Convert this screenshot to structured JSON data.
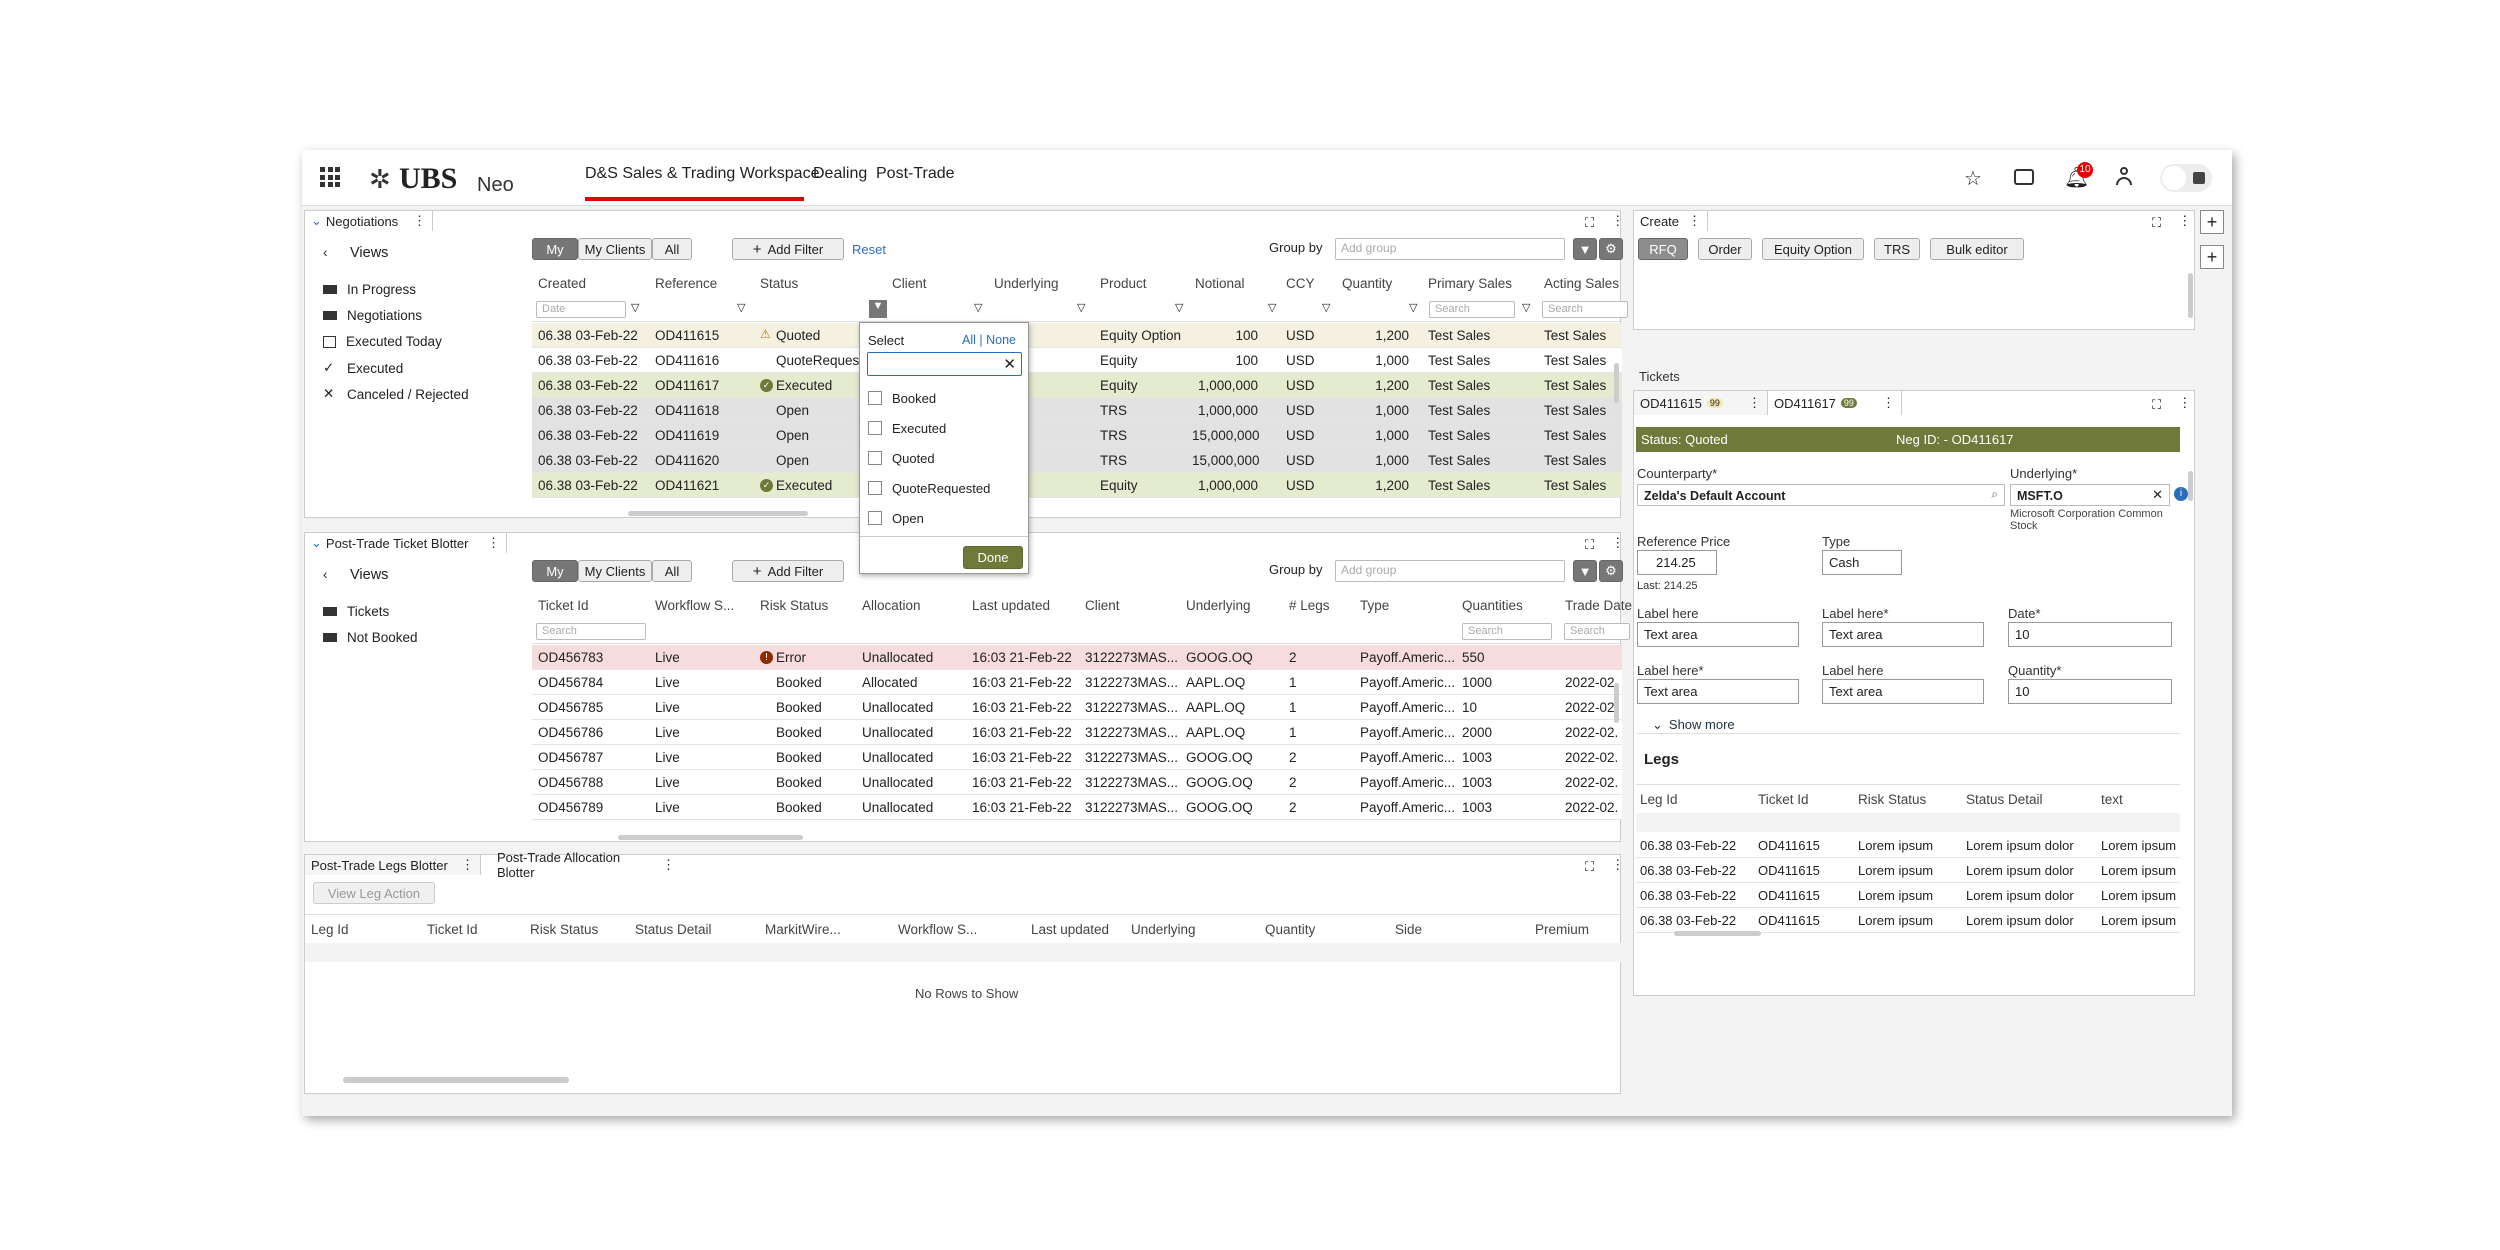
{
  "brand": {
    "logo": "UBS",
    "product": "Neo"
  },
  "nav": {
    "items": [
      "D&S Sales & Trading Workspace",
      "Dealing",
      "Post-Trade"
    ],
    "active": 0
  },
  "notifications": {
    "count": "10"
  },
  "negotiations": {
    "tab": "Negotiations",
    "views_title": "Views",
    "views": [
      "In Progress",
      "Negotiations",
      "Executed Today",
      "Executed",
      "Canceled / Rejected"
    ],
    "seg": [
      "My",
      "My Clients",
      "All"
    ],
    "add_filter": "Add Filter",
    "reset": "Reset",
    "group_by": "Group by",
    "group_placeholder": "Add group",
    "headers": [
      "Created",
      "Reference",
      "Status",
      "Client",
      "Underlying",
      "Product",
      "Notional",
      "CCY",
      "Quantity",
      "Primary Sales",
      "Acting Sales"
    ],
    "date_placeholder": "Date",
    "search_placeholder": "Search",
    "rows": [
      {
        "created": "06.38 03-Feb-22",
        "ref": "OD411615",
        "status": "Quoted",
        "product": "Equity Option",
        "notional": "100",
        "ccy": "USD",
        "qty": "1,200",
        "ps": "Test Sales",
        "as": "Test Sales"
      },
      {
        "created": "06.38 03-Feb-22",
        "ref": "OD411616",
        "status": "QuoteRequested",
        "product": "Equity",
        "notional": "100",
        "ccy": "USD",
        "qty": "1,000",
        "ps": "Test Sales",
        "as": "Test Sales"
      },
      {
        "created": "06.38 03-Feb-22",
        "ref": "OD411617",
        "status": "Executed",
        "product": "Equity",
        "notional": "1,000,000",
        "ccy": "USD",
        "qty": "1,200",
        "ps": "Test Sales",
        "as": "Test Sales"
      },
      {
        "created": "06.38 03-Feb-22",
        "ref": "OD411618",
        "status": "Open",
        "product": "TRS",
        "notional": "1,000,000",
        "ccy": "USD",
        "qty": "1,000",
        "ps": "Test Sales",
        "as": "Test Sales"
      },
      {
        "created": "06.38 03-Feb-22",
        "ref": "OD411619",
        "status": "Open",
        "product": "TRS",
        "notional": "15,000,000",
        "ccy": "USD",
        "qty": "1,000",
        "ps": "Test Sales",
        "as": "Test Sales"
      },
      {
        "created": "06.38 03-Feb-22",
        "ref": "OD411620",
        "status": "Open",
        "product": "TRS",
        "notional": "15,000,000",
        "ccy": "USD",
        "qty": "1,000",
        "ps": "Test Sales",
        "as": "Test Sales"
      },
      {
        "created": "06.38 03-Feb-22",
        "ref": "OD411621",
        "status": "Executed",
        "product": "Equity",
        "notional": "1,000,000",
        "ccy": "USD",
        "qty": "1,200",
        "ps": "Test Sales",
        "as": "Test Sales"
      }
    ],
    "popup": {
      "title": "Select",
      "all_none": "All | None",
      "options": [
        "Booked",
        "Executed",
        "Quoted",
        "QuoteRequested",
        "Open"
      ],
      "done": "Done"
    }
  },
  "ptb": {
    "tab": "Post-Trade Ticket Blotter",
    "views_title": "Views",
    "views": [
      "Tickets",
      "Not Booked"
    ],
    "headers": [
      "Ticket Id",
      "Workflow S...",
      "Risk Status",
      "Allocation",
      "Last updated",
      "Client",
      "Underlying",
      "# Legs",
      "Type",
      "Quantities",
      "Trade Date"
    ],
    "rows": [
      {
        "id": "OD456783",
        "wf": "Live",
        "risk": "Error",
        "alloc": "Unallocated",
        "upd": "16:03 21-Feb-22",
        "client": "3122273MAS...",
        "und": "GOOG.OQ",
        "legs": "2",
        "type": "Payoff.Americ...",
        "qty": "550",
        "td": ""
      },
      {
        "id": "OD456784",
        "wf": "Live",
        "risk": "Booked",
        "alloc": "Allocated",
        "upd": "16:03 21-Feb-22",
        "client": "3122273MAS...",
        "und": "AAPL.OQ",
        "legs": "1",
        "type": "Payoff.Americ...",
        "qty": "1000",
        "td": "2022-02."
      },
      {
        "id": "OD456785",
        "wf": "Live",
        "risk": "Booked",
        "alloc": "Unallocated",
        "upd": "16:03 21-Feb-22",
        "client": "3122273MAS...",
        "und": "AAPL.OQ",
        "legs": "1",
        "type": "Payoff.Americ...",
        "qty": "10",
        "td": "2022-02."
      },
      {
        "id": "OD456786",
        "wf": "Live",
        "risk": "Booked",
        "alloc": "Unallocated",
        "upd": "16:03 21-Feb-22",
        "client": "3122273MAS...",
        "und": "AAPL.OQ",
        "legs": "1",
        "type": "Payoff.Americ...",
        "qty": "2000",
        "td": "2022-02."
      },
      {
        "id": "OD456787",
        "wf": "Live",
        "risk": "Booked",
        "alloc": "Unallocated",
        "upd": "16:03 21-Feb-22",
        "client": "3122273MAS...",
        "und": "GOOG.OQ",
        "legs": "2",
        "type": "Payoff.Americ...",
        "qty": "1003",
        "td": "2022-02."
      },
      {
        "id": "OD456788",
        "wf": "Live",
        "risk": "Booked",
        "alloc": "Unallocated",
        "upd": "16:03 21-Feb-22",
        "client": "3122273MAS...",
        "und": "GOOG.OQ",
        "legs": "2",
        "type": "Payoff.Americ...",
        "qty": "1003",
        "td": "2022-02."
      },
      {
        "id": "OD456789",
        "wf": "Live",
        "risk": "Booked",
        "alloc": "Unallocated",
        "upd": "16:03 21-Feb-22",
        "client": "3122273MAS...",
        "und": "GOOG.OQ",
        "legs": "2",
        "type": "Payoff.Americ...",
        "qty": "1003",
        "td": "2022-02."
      }
    ]
  },
  "legs_blotter": {
    "tabs": [
      "Post-Trade Legs Blotter",
      "Post-Trade Allocation Blotter"
    ],
    "action": "View Leg Action",
    "headers": [
      "Leg Id",
      "Ticket Id",
      "Risk Status",
      "Status Detail",
      "MarkitWire...",
      "Workflow S...",
      "Last updated",
      "Underlying",
      "Quantity",
      "Side",
      "Premium"
    ],
    "empty": "No Rows to Show"
  },
  "create": {
    "tab": "Create",
    "buttons": [
      "RFQ",
      "Order",
      "Equity Option",
      "TRS",
      "Bulk editor"
    ]
  },
  "tickets": {
    "title": "Tickets",
    "tabs": [
      {
        "id": "OD411615",
        "badge": "99"
      },
      {
        "id": "OD411617",
        "badge": "99"
      }
    ],
    "status": "Status: Quoted",
    "neg_id": "Neg ID: - OD411617",
    "counterparty_label": "Counterparty*",
    "counterparty": "Zelda's Default Account",
    "underlying_label": "Underlying*",
    "underlying": "MSFT.O",
    "underlying_desc": "Microsoft Corporation Common Stock",
    "ref_price_label": "Reference Price",
    "ref_price": "214.25",
    "last": "Last: 214.25",
    "type_label": "Type",
    "type": "Cash",
    "fields": [
      {
        "label": "Label here",
        "value": "Text area"
      },
      {
        "label": "Label here*",
        "value": "Text area"
      },
      {
        "label": "Date*",
        "value": "10"
      },
      {
        "label": "Label here*",
        "value": "Text area"
      },
      {
        "label": "Label here",
        "value": "Text area"
      },
      {
        "label": "Quantity*",
        "value": "10"
      }
    ],
    "show_more": "Show more",
    "legs_title": "Legs",
    "legs_headers": [
      "Leg Id",
      "Ticket Id",
      "Risk Status",
      "Status Detail",
      "text"
    ],
    "legs_rows": [
      [
        "06.38 03-Feb-22",
        "OD411615",
        "Lorem ipsum",
        "Lorem ipsum dolor",
        "Lorem ipsum"
      ],
      [
        "06.38 03-Feb-22",
        "OD411615",
        "Lorem ipsum",
        "Lorem ipsum dolor",
        "Lorem ipsum"
      ],
      [
        "06.38 03-Feb-22",
        "OD411615",
        "Lorem ipsum",
        "Lorem ipsum dolor",
        "Lorem ipsum"
      ],
      [
        "06.38 03-Feb-22",
        "OD411615",
        "Lorem ipsum",
        "Lorem ipsum dolor",
        "Lorem ipsum"
      ]
    ]
  },
  "colors": {
    "accent": "#e60000",
    "olive": "#6f7a3a",
    "executed_row": "#e4ebcf",
    "open_row": "#e2e2e2",
    "error_row": "#f6dcdc"
  }
}
